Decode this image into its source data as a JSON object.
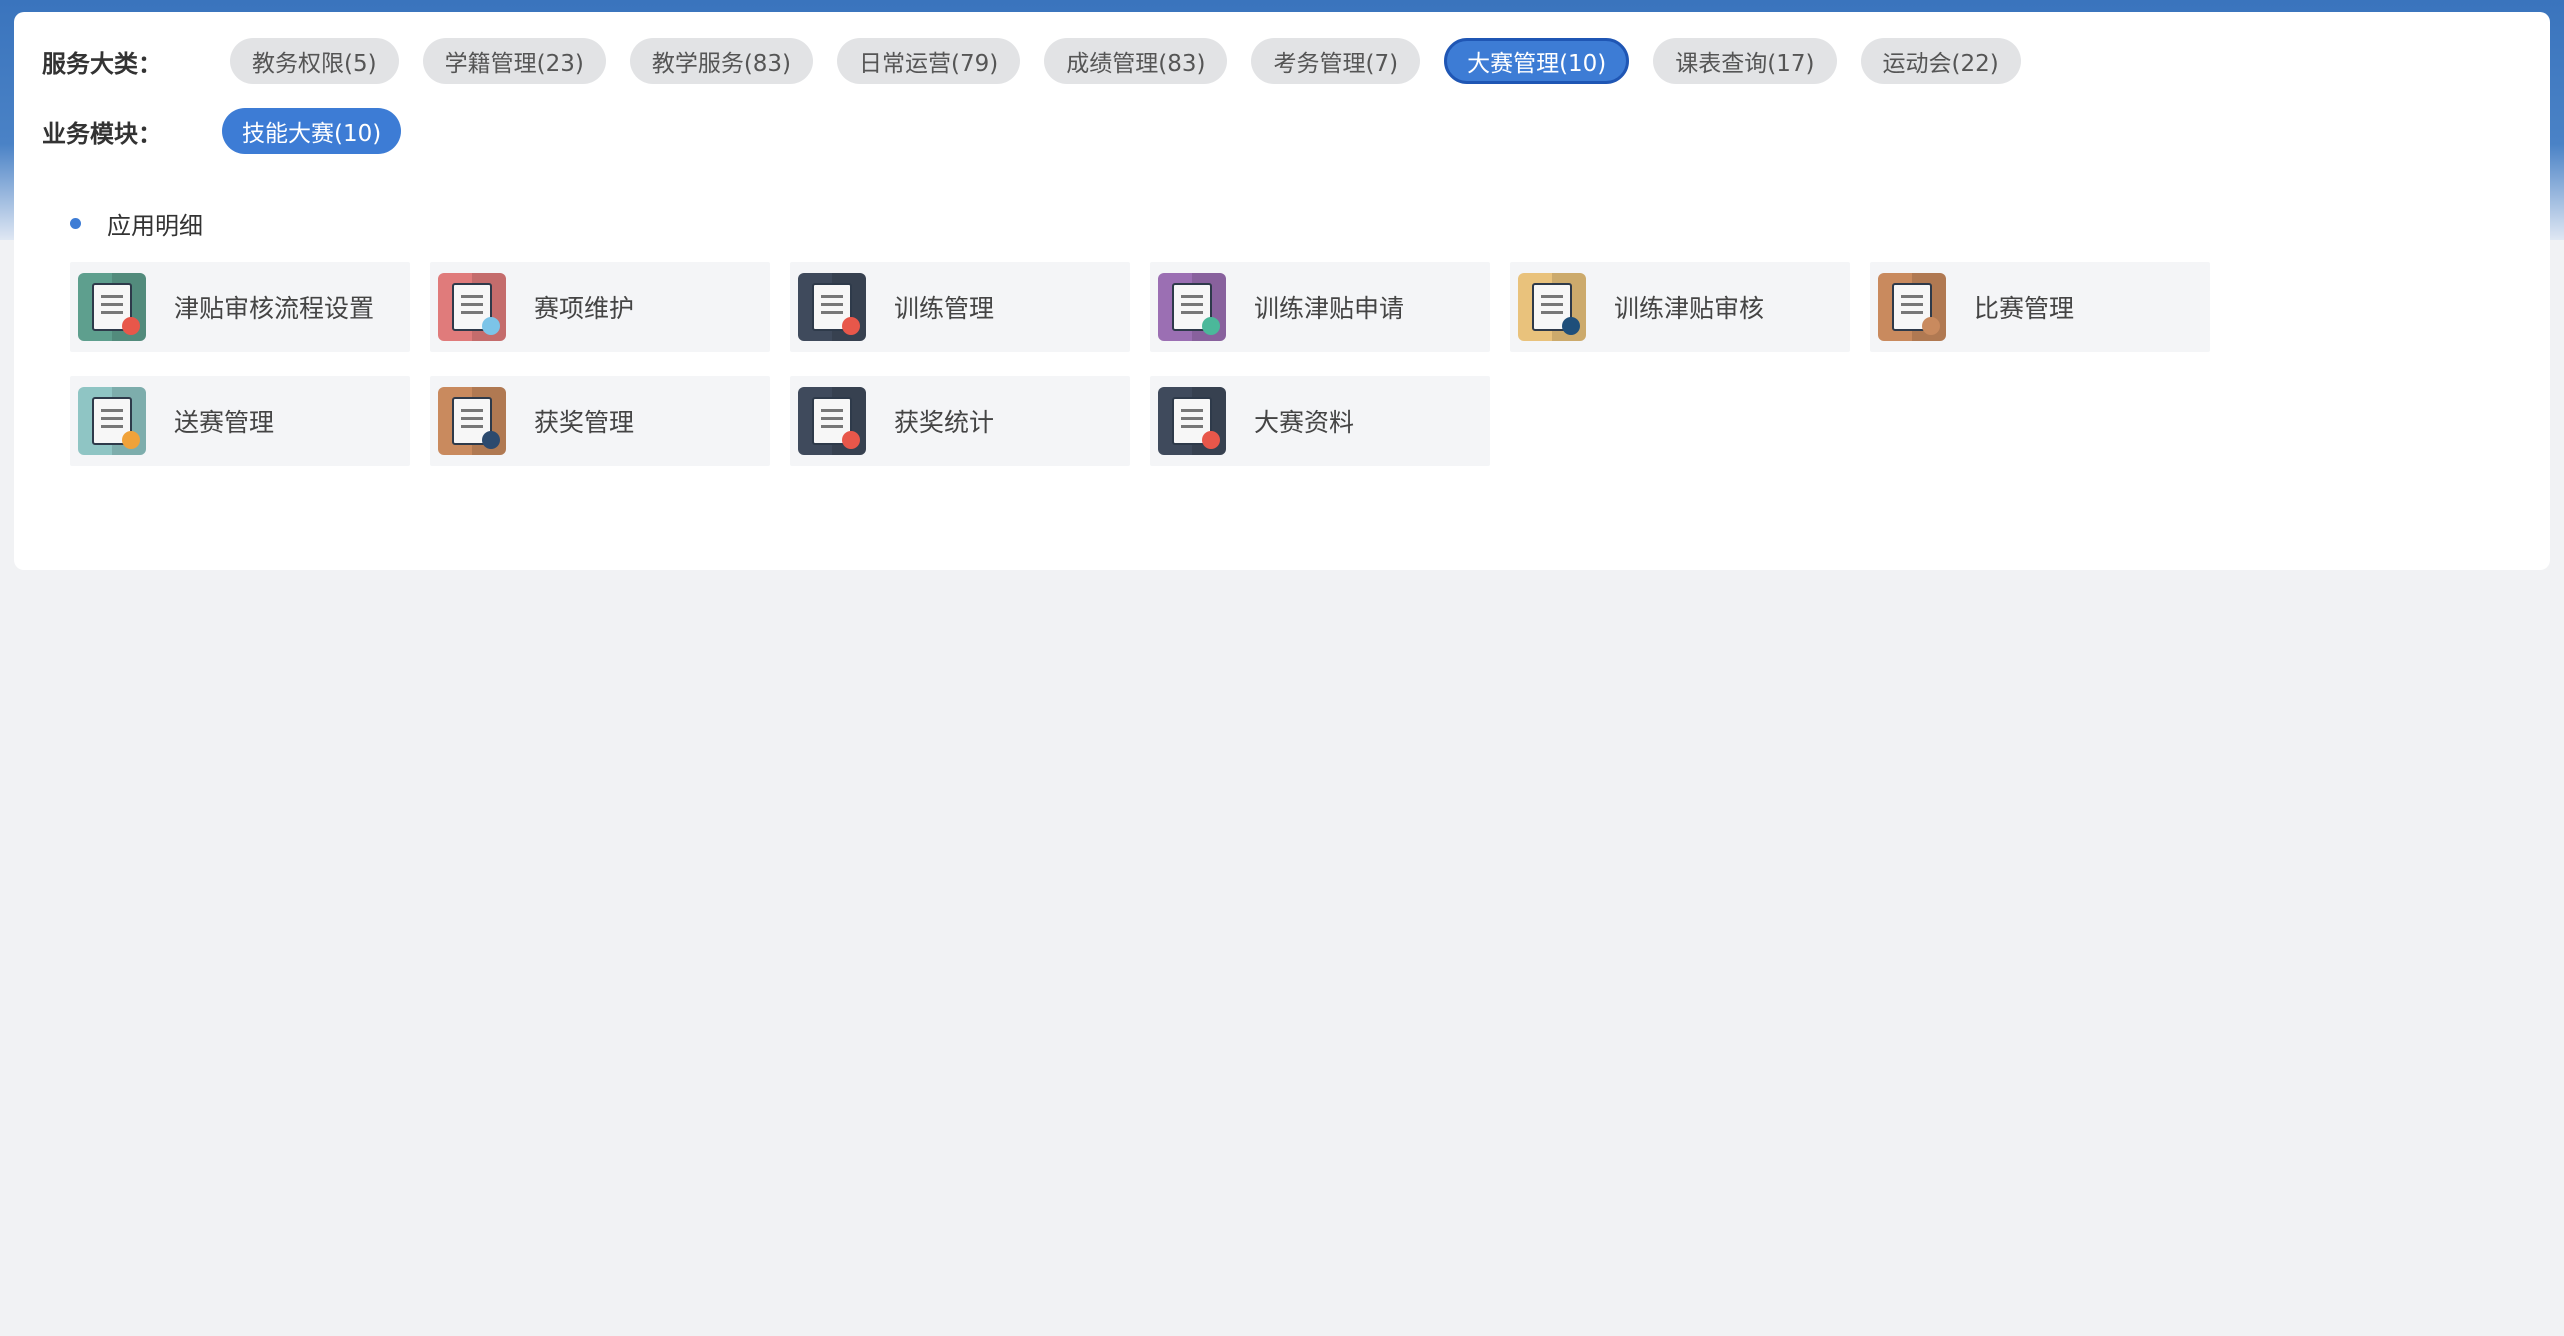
{
  "filters": {
    "category_label": "服务大类：",
    "module_label": "业务模块：",
    "categories": [
      {
        "label": "教务权限(5)",
        "active": false
      },
      {
        "label": "学籍管理(23)",
        "active": false
      },
      {
        "label": "教学服务(83)",
        "active": false
      },
      {
        "label": "日常运营(79)",
        "active": false
      },
      {
        "label": "成绩管理(83)",
        "active": false
      },
      {
        "label": "考务管理(7)",
        "active": false
      },
      {
        "label": "大赛管理(10)",
        "active": true
      },
      {
        "label": "课表查询(17)",
        "active": false
      },
      {
        "label": "运动会(22)",
        "active": false
      }
    ],
    "modules": [
      {
        "label": "技能大赛(10)",
        "active": true
      }
    ]
  },
  "section": {
    "title": "应用明细"
  },
  "apps": [
    {
      "label": "津贴审核流程设置",
      "icon": "warning-monitor-icon",
      "color": "#5e9f8e",
      "badge_color": "#e8574a"
    },
    {
      "label": "赛项维护",
      "icon": "cube-icon",
      "color": "#e07b7b",
      "badge_color": "#7cc4e8"
    },
    {
      "label": "训练管理",
      "icon": "chart-screen-icon",
      "color": "#3f4a5c",
      "badge_color": "#e8574a"
    },
    {
      "label": "训练津贴申请",
      "icon": "clipboard-tool-icon",
      "color": "#9b6fb3",
      "badge_color": "#4bb89a"
    },
    {
      "label": "训练津贴审核",
      "icon": "clipboard-pen-icon",
      "color": "#e9c27c",
      "badge_color": "#1f4f7a"
    },
    {
      "label": "比赛管理",
      "icon": "document-icon",
      "color": "#c98a5e",
      "badge_color": "#c98a5e"
    },
    {
      "label": "送赛管理",
      "icon": "clipboard-user-icon",
      "color": "#8fc5c4",
      "badge_color": "#f0a23a"
    },
    {
      "label": "获奖管理",
      "icon": "monitor-chart-icon",
      "color": "#c98a5e",
      "badge_color": "#2c4a6e"
    },
    {
      "label": "获奖统计",
      "icon": "chart-screen-icon",
      "color": "#3f4a5c",
      "badge_color": "#e8574a"
    },
    {
      "label": "大赛资料",
      "icon": "chart-screen-icon",
      "color": "#3f4a5c",
      "badge_color": "#e8574a"
    }
  ]
}
